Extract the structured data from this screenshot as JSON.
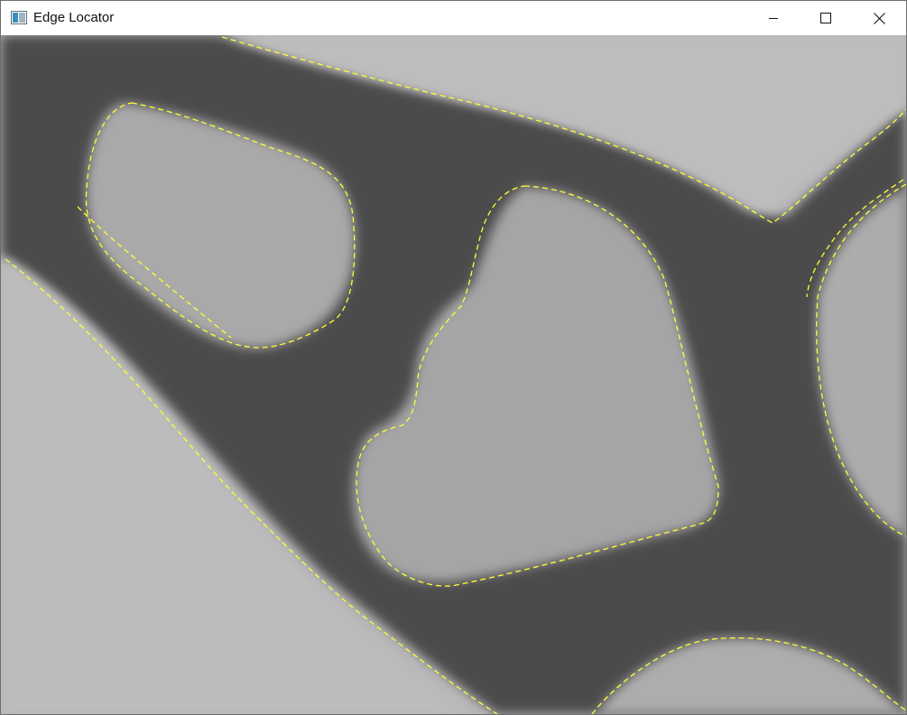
{
  "window": {
    "title": "Edge Locator",
    "app_icon": "image-window-icon",
    "controls": {
      "minimize_icon": "minimize-icon",
      "maximize_icon": "maximize-icon",
      "close_icon": "close-icon"
    }
  },
  "image_view": {
    "description_icon": "grayscale-micrograph",
    "overlay_color": "#ffff33",
    "background_light": "#b9b9b9",
    "channel_dark": "#4a4a4a",
    "blob_fill": "#a6a6a6"
  }
}
